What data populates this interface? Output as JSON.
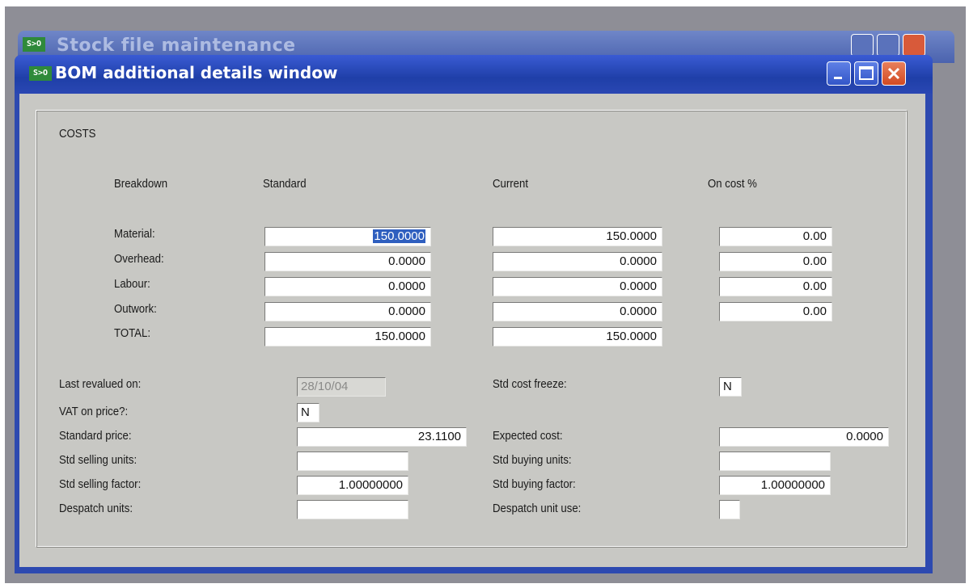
{
  "back_window": {
    "title": "Stock file maintenance",
    "icon_text": "S>O"
  },
  "window": {
    "title": "BOM additional details window",
    "icon_text": "S>O"
  },
  "costs": {
    "heading": "COSTS",
    "columns": {
      "breakdown": "Breakdown",
      "standard": "Standard",
      "current": "Current",
      "on_cost": "On cost %"
    },
    "rows": [
      {
        "label": "Material:",
        "standard": "150.0000",
        "current": "150.0000",
        "on_cost": "0.00"
      },
      {
        "label": "Overhead:",
        "standard": "0.0000",
        "current": "0.0000",
        "on_cost": "0.00"
      },
      {
        "label": "Labour:",
        "standard": "0.0000",
        "current": "0.0000",
        "on_cost": "0.00"
      },
      {
        "label": "Outwork:",
        "standard": "0.0000",
        "current": "0.0000",
        "on_cost": "0.00"
      }
    ],
    "total": {
      "label": "TOTAL:",
      "standard": "150.0000",
      "current": "150.0000"
    }
  },
  "details": {
    "last_revalued": {
      "label": "Last revalued on:",
      "value": "28/10/04"
    },
    "vat_on_price": {
      "label": "VAT on price?:",
      "value": "N"
    },
    "standard_price": {
      "label": "Standard price:",
      "value": "23.1100"
    },
    "std_selling_units": {
      "label": "Std selling units:",
      "value": ""
    },
    "std_selling_factor": {
      "label": "Std selling factor:",
      "value": "1.00000000"
    },
    "despatch_units": {
      "label": "Despatch units:",
      "value": ""
    },
    "std_cost_freeze": {
      "label": "Std cost freeze:",
      "value": "N"
    },
    "expected_cost": {
      "label": "Expected cost:",
      "value": "0.0000"
    },
    "std_buying_units": {
      "label": "Std buying units:",
      "value": ""
    },
    "std_buying_factor": {
      "label": "Std buying factor:",
      "value": "1.00000000"
    },
    "despatch_unit_use": {
      "label": "Despatch unit use:",
      "value": ""
    }
  },
  "colors": {
    "titlebar": "#2d49b0",
    "client": "#c8c8c4",
    "selection": "#2f5fbf"
  }
}
